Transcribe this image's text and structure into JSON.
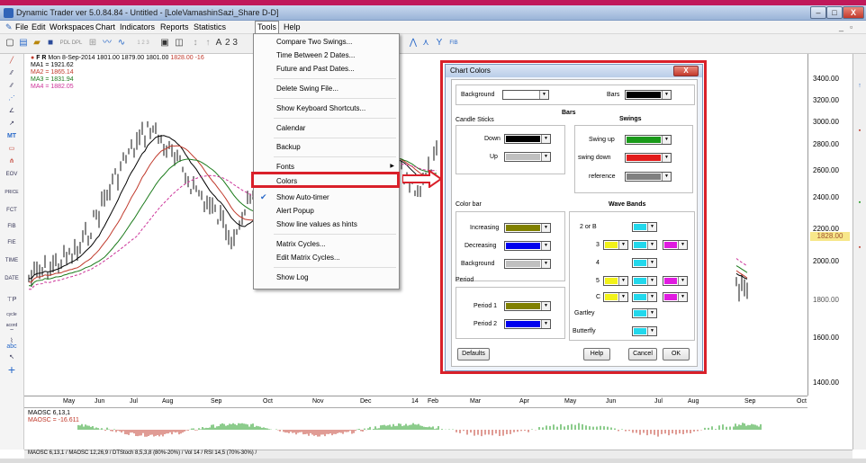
{
  "window": {
    "title": "Dynamic Trader ver 5.0.84.84 - Untitled - [LoleVamashinSazi_Share D-D]",
    "min": "–",
    "max": "□",
    "close": "X"
  },
  "menus": [
    "File",
    "Edit",
    "Workspaces",
    "Chart",
    "Indicators",
    "Reports",
    "Statistics",
    "Tools",
    "Help"
  ],
  "chart_header": {
    "symbol": "F R",
    "date": "Mon 8-Sep-2014",
    "open": "1801.00",
    "high": "1879.00",
    "low": "1801.00",
    "close": "1828.00",
    "chg": "-16"
  },
  "ma": [
    {
      "label": "MA1 = 1921.62",
      "color": "#000000"
    },
    {
      "label": "MA2 = 1865.14",
      "color": "#c0392b"
    },
    {
      "label": "MA3 = 1831.94",
      "color": "#1a7a1a"
    },
    {
      "label": "MA4 = 1882.05",
      "color": "#cc3399"
    }
  ],
  "left_tools": [
    "MT",
    "EOV",
    "PRICE",
    "FCT",
    "FIB",
    "FIE",
    "TIME",
    "DATE",
    "cycle acord",
    "abc"
  ],
  "yaxis": [
    "3400.00",
    "3200.00",
    "3000.00",
    "2800.00",
    "2600.00",
    "2400.00",
    "2200.00",
    "2000.00",
    "1600.00",
    "1400.00"
  ],
  "price_badge": "1828.00",
  "price_badge2": "1800.00",
  "xaxis": [
    "May",
    "Jun",
    "Jul",
    "Aug",
    "Sep",
    "Oct",
    "Nov",
    "Dec",
    "14",
    "Feb",
    "Mar",
    "Apr",
    "May",
    "Jun",
    "Jul",
    "Aug",
    "Sep",
    "Oct"
  ],
  "oscillator": {
    "line1": "MAOSC 6,13,1",
    "line2": "MAOSC = -16.611"
  },
  "tabs_text": "MAOSC 6,13,1 / MAOSC 12,26,9 / DTStoch 8,5,3,8 (80%-20%) / Vol 14 / RSI 14,5 (70%-30%) /",
  "tools_menu": [
    "Compare Two Swings...",
    "Time Between 2 Dates...",
    "Future and Past Dates...",
    "Delete Swing File...",
    "Show Keyboard Shortcuts...",
    "Calendar",
    "Backup",
    "Fonts",
    "Colors",
    "Show Auto-timer",
    "Alert Popup",
    "Show line values as hints",
    "Matrix Cycles...",
    "Edit Matrix Cycles...",
    "Show Log"
  ],
  "dialog": {
    "title": "Chart Colors",
    "close": "X",
    "background_label": "Background",
    "bars_label": "Bars",
    "bars_header": "Bars",
    "candle_sticks": "Candle Sticks",
    "down": "Down",
    "up": "Up",
    "swings_header": "Swings",
    "swing_up": "Swing up",
    "swing_down": "swing down",
    "reference": "reference",
    "color_bar": "Color bar",
    "increasing": "Increasing",
    "decreasing": "Decreasing",
    "background2": "Background",
    "period": "Period",
    "period1": "Period 1",
    "period2": "Period 2",
    "wave_bands": "Wave Bands",
    "wb_rows": [
      "2 or B",
      "3",
      "4",
      "5",
      "C"
    ],
    "gartley": "Gartley",
    "butterfly": "Butterfly",
    "defaults": "Defaults",
    "help": "Help",
    "cancel": "Cancel",
    "ok": "OK"
  },
  "colors": {
    "bg": "#ffffff",
    "bars": "#000000",
    "down": "#000000",
    "up": "#c0c0c0",
    "swing_up": "#1a9a1a",
    "swing_down": "#e21b1b",
    "reference": "#808080",
    "increasing": "#808000",
    "decreasing": "#0000ee",
    "background2": "#c0c0c0",
    "period1": "#808000",
    "period2": "#0000ee",
    "cyan": "#22d8ec",
    "yellow": "#f2f21a",
    "magenta": "#e01be0",
    "highlight": "#d9202a"
  }
}
